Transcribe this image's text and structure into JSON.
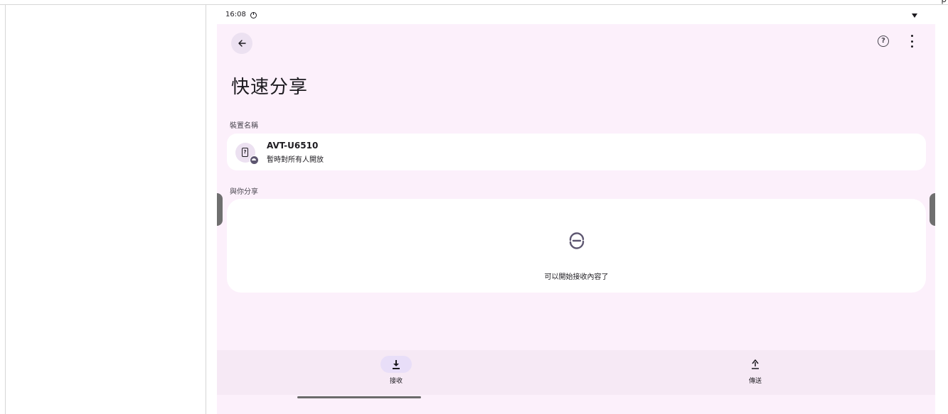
{
  "corner_text": "p",
  "status_bar": {
    "time": "16:08"
  },
  "header": {
    "back_icon": "arrow-left-icon",
    "help_icon": "help-circle-icon",
    "more_icon": "more-vert-icon",
    "title": "快速分享"
  },
  "device_section": {
    "label": "裝置名稱",
    "device_name": "AVT-U6510",
    "visibility": "暫時對所有人開放"
  },
  "shared_section": {
    "label": "與你分享",
    "status_text": "可以開始接收內容了"
  },
  "bottom_nav": {
    "receive_label": "接收",
    "send_label": "傳送"
  },
  "colors": {
    "screen_bg": "#fcf0fb",
    "card_bg": "#ffffff",
    "accent": "#5d5670",
    "active_pill": "#e8def8"
  }
}
